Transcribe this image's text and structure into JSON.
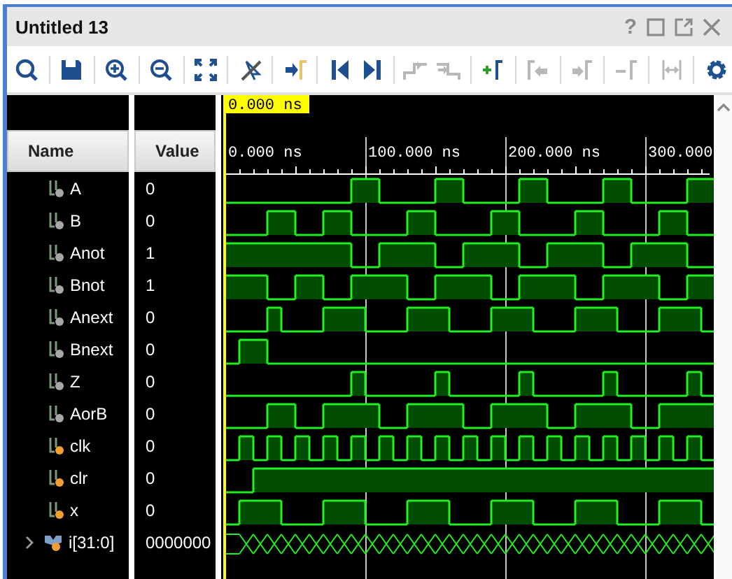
{
  "window": {
    "title": "Untitled 13",
    "help": "?"
  },
  "toolbar": [
    [
      {
        "kind": "search",
        "disabled": false
      }
    ],
    [
      {
        "kind": "save",
        "disabled": false
      }
    ],
    [
      {
        "kind": "zoom-in",
        "disabled": false
      }
    ],
    [
      {
        "kind": "zoom-out",
        "disabled": false
      }
    ],
    [
      {
        "kind": "fit",
        "disabled": false
      }
    ],
    [
      {
        "kind": "snap",
        "disabled": false
      }
    ],
    [
      {
        "kind": "goto-cursor",
        "disabled": false
      }
    ],
    [
      {
        "kind": "go-start",
        "disabled": false
      },
      {
        "kind": "go-end",
        "disabled": false
      }
    ],
    [
      {
        "kind": "prev-transition",
        "disabled": true
      },
      {
        "kind": "next-transition",
        "disabled": true
      }
    ],
    [
      {
        "kind": "add-marker",
        "disabled": false
      }
    ],
    [
      {
        "kind": "prev-marker",
        "disabled": true
      }
    ],
    [
      {
        "kind": "next-marker",
        "disabled": true
      }
    ],
    [
      {
        "kind": "remove-marker",
        "disabled": true
      }
    ],
    [
      {
        "kind": "marker-distance",
        "disabled": true
      }
    ],
    [
      {
        "kind": "settings",
        "disabled": false
      }
    ]
  ],
  "columns": {
    "name": "Name",
    "value": "Value"
  },
  "timeline": {
    "cursor": "0.000 ns",
    "labels": [
      "0.000 ns",
      "100.000 ns",
      "200.000 ns",
      "300.000"
    ]
  },
  "signals": [
    {
      "name": "A",
      "value": "0",
      "kind": "output",
      "high": [
        false,
        false,
        false,
        false,
        false,
        false,
        false,
        false,
        false,
        true,
        true,
        false,
        false,
        false,
        false,
        true,
        true,
        false,
        false,
        false,
        false,
        true,
        true,
        false,
        false,
        false,
        false,
        true,
        true,
        false,
        false,
        false,
        false,
        true,
        true
      ]
    },
    {
      "name": "B",
      "value": "0",
      "kind": "output",
      "high": [
        false,
        false,
        false,
        true,
        true,
        false,
        false,
        true,
        true,
        false,
        false,
        false,
        false,
        true,
        true,
        false,
        false,
        false,
        false,
        true,
        true,
        false,
        false,
        false,
        false,
        true,
        true,
        false,
        false,
        false,
        false,
        true,
        true,
        false,
        false
      ]
    },
    {
      "name": "Anot",
      "value": "1",
      "kind": "output",
      "high": [
        true,
        true,
        true,
        true,
        true,
        true,
        true,
        true,
        true,
        false,
        false,
        true,
        true,
        true,
        true,
        false,
        false,
        true,
        true,
        true,
        true,
        false,
        false,
        true,
        true,
        true,
        true,
        false,
        false,
        true,
        true,
        true,
        true,
        false,
        false
      ]
    },
    {
      "name": "Bnot",
      "value": "1",
      "kind": "output",
      "high": [
        true,
        true,
        true,
        false,
        false,
        true,
        true,
        false,
        false,
        true,
        true,
        true,
        true,
        false,
        false,
        true,
        true,
        true,
        true,
        false,
        false,
        true,
        true,
        true,
        true,
        false,
        false,
        true,
        true,
        true,
        true,
        false,
        false,
        true,
        true
      ]
    },
    {
      "name": "Anext",
      "value": "0",
      "kind": "output",
      "high": [
        false,
        false,
        false,
        true,
        false,
        false,
        false,
        true,
        true,
        true,
        false,
        false,
        false,
        true,
        true,
        true,
        false,
        false,
        false,
        true,
        true,
        true,
        false,
        false,
        false,
        true,
        true,
        true,
        false,
        false,
        false,
        true,
        true,
        true,
        false
      ]
    },
    {
      "name": "Bnext",
      "value": "0",
      "kind": "output",
      "high": [
        false,
        true,
        true,
        false,
        false,
        false,
        false,
        false,
        false,
        false,
        false,
        false,
        false,
        false,
        false,
        false,
        false,
        false,
        false,
        false,
        false,
        false,
        false,
        false,
        false,
        false,
        false,
        false,
        false,
        false,
        false,
        false,
        false,
        false,
        false
      ]
    },
    {
      "name": "Z",
      "value": "0",
      "kind": "output",
      "high": [
        false,
        false,
        false,
        false,
        false,
        false,
        false,
        false,
        false,
        true,
        false,
        false,
        false,
        false,
        false,
        true,
        false,
        false,
        false,
        false,
        false,
        true,
        false,
        false,
        false,
        false,
        false,
        true,
        false,
        false,
        false,
        false,
        false,
        true,
        false
      ]
    },
    {
      "name": "AorB",
      "value": "0",
      "kind": "output",
      "high": [
        false,
        false,
        false,
        true,
        true,
        false,
        false,
        true,
        true,
        true,
        true,
        false,
        false,
        true,
        true,
        true,
        true,
        false,
        false,
        true,
        true,
        true,
        true,
        false,
        false,
        true,
        true,
        true,
        true,
        false,
        false,
        true,
        true,
        true,
        true
      ]
    },
    {
      "name": "clk",
      "value": "0",
      "kind": "input",
      "high": [
        false,
        true,
        false,
        true,
        false,
        true,
        false,
        true,
        false,
        true,
        false,
        true,
        false,
        true,
        false,
        true,
        false,
        true,
        false,
        true,
        false,
        true,
        false,
        true,
        false,
        true,
        false,
        true,
        false,
        true,
        false,
        true,
        false,
        true,
        false
      ]
    },
    {
      "name": "clr",
      "value": "0",
      "kind": "input",
      "high": [
        false,
        false,
        true,
        true,
        true,
        true,
        true,
        true,
        true,
        true,
        true,
        true,
        true,
        true,
        true,
        true,
        true,
        true,
        true,
        true,
        true,
        true,
        true,
        true,
        true,
        true,
        true,
        true,
        true,
        true,
        true,
        true,
        true,
        true,
        true
      ]
    },
    {
      "name": "x",
      "value": "0",
      "kind": "input",
      "high": [
        false,
        true,
        true,
        true,
        false,
        false,
        false,
        true,
        true,
        true,
        false,
        false,
        false,
        true,
        true,
        true,
        false,
        false,
        false,
        true,
        true,
        true,
        false,
        false,
        false,
        true,
        true,
        true,
        false,
        false,
        false,
        true,
        true,
        true,
        false
      ]
    },
    {
      "name": "i[31:0]",
      "value": "0000000",
      "kind": "bus",
      "expanded": false,
      "change": [
        false,
        true,
        true,
        true,
        true,
        true,
        true,
        true,
        true,
        true,
        true,
        true,
        true,
        true,
        true,
        true,
        true,
        true,
        true,
        true,
        true,
        true,
        true,
        true,
        true,
        true,
        true,
        true,
        true,
        true,
        true,
        true,
        true,
        true,
        true
      ]
    }
  ]
}
